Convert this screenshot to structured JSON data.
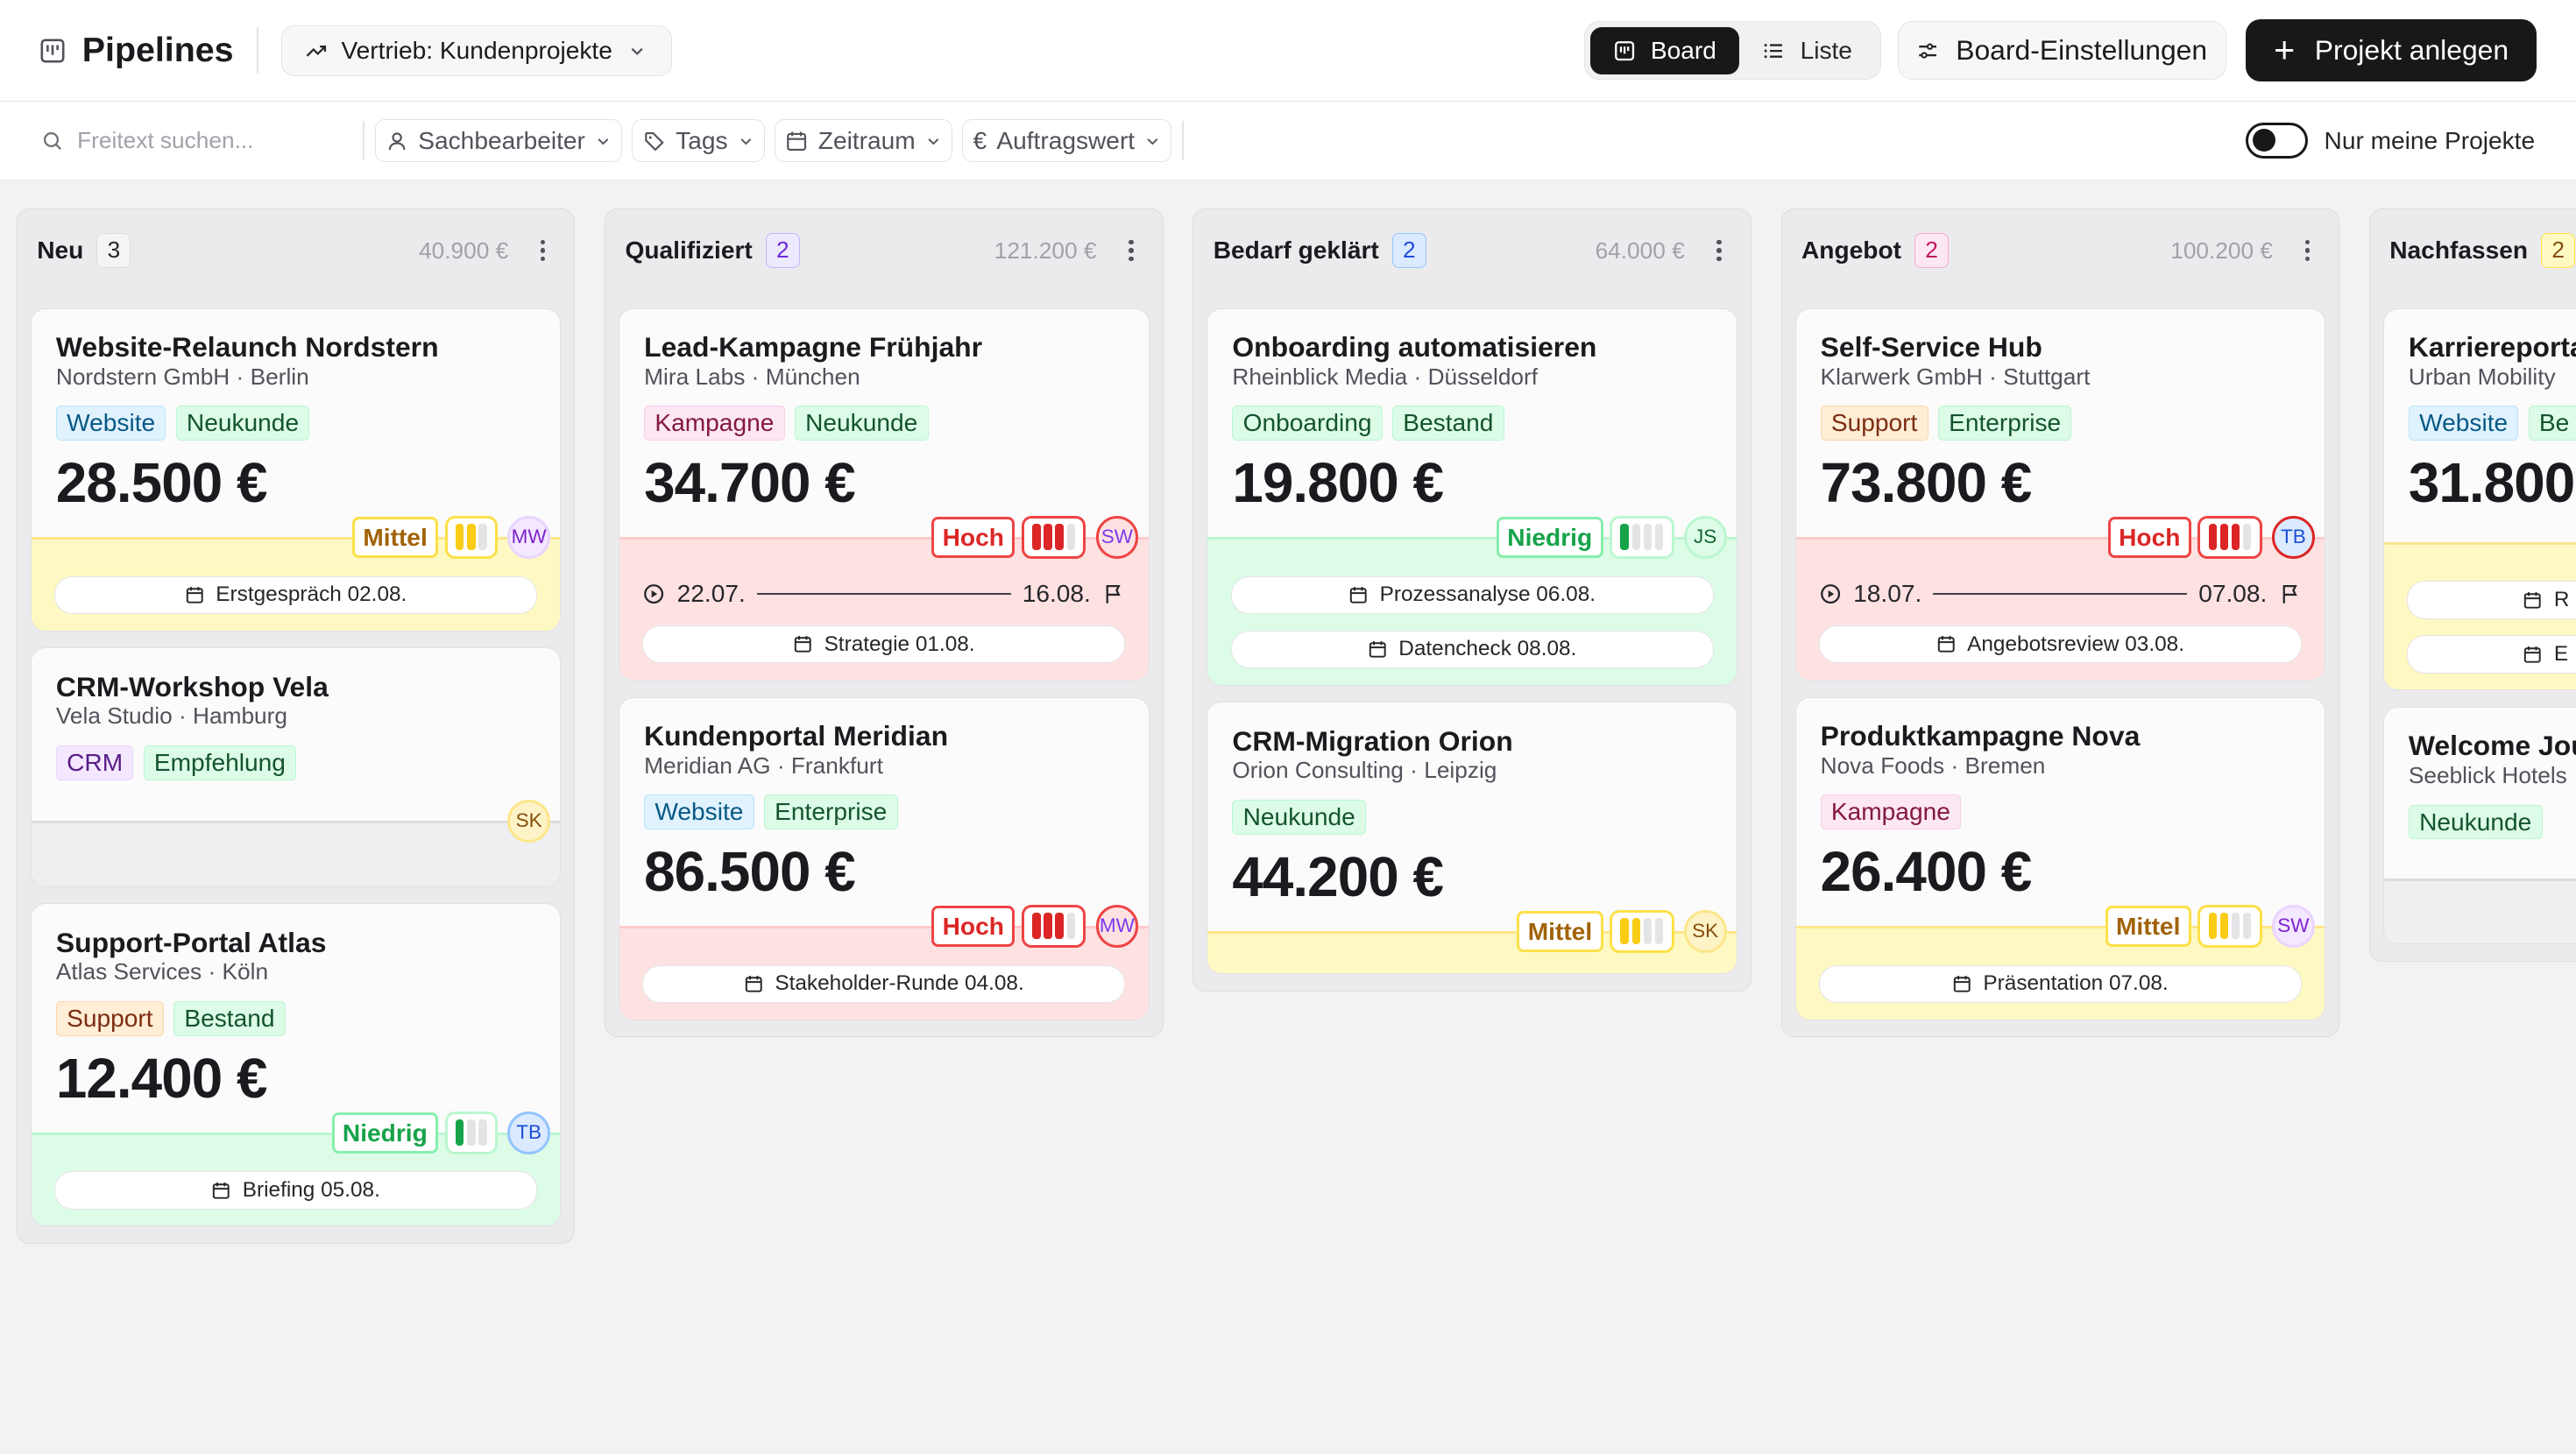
{
  "header": {
    "title": "Pipelines",
    "pipeline": "Vertrieb: Kundenprojekte",
    "view_board": "Board",
    "view_list": "Liste",
    "board_settings": "Board-Einstellungen",
    "create": "Projekt anlegen"
  },
  "filters": {
    "search_placeholder": "Freitext suchen...",
    "assignee": "Sachbearbeiter",
    "tags": "Tags",
    "period": "Zeitraum",
    "value": "Auftragswert",
    "only_mine": "Nur meine Projekte"
  },
  "columns": {
    "neu": {
      "title": "Neu",
      "count": "3",
      "sum": "40.900 €"
    },
    "qual": {
      "title": "Qualifiziert",
      "count": "2",
      "sum": "121.200 €"
    },
    "bedarf": {
      "title": "Bedarf geklärt",
      "count": "2",
      "sum": "64.000 €"
    },
    "angebot": {
      "title": "Angebot",
      "count": "2",
      "sum": "100.200 €"
    },
    "nach": {
      "title": "Nachfassen",
      "count": "2"
    }
  },
  "cards": {
    "nordstern": {
      "title": "Website-Relaunch Nordstern",
      "company": "Nordstern GmbH · Berlin",
      "tags": [
        "Website",
        "Neukunde"
      ],
      "amount": "28.500 €",
      "priority": "Mittel",
      "level": 2,
      "assignee": "MW",
      "tasks": [
        "Erstgespräch 02.08."
      ]
    },
    "vela": {
      "title": "CRM-Workshop Vela",
      "company": "Vela Studio · Hamburg",
      "tags": [
        "CRM",
        "Empfehlung"
      ],
      "assignee": "SK"
    },
    "atlas": {
      "title": "Support-Portal Atlas",
      "company": "Atlas Services · Köln",
      "tags": [
        "Support",
        "Bestand"
      ],
      "amount": "12.400 €",
      "priority": "Niedrig",
      "level": 1,
      "assignee": "TB",
      "tasks": [
        "Briefing 05.08."
      ]
    },
    "mira": {
      "title": "Lead-Kampagne Frühjahr",
      "company": "Mira Labs · München",
      "tags": [
        "Kampagne",
        "Neukunde"
      ],
      "amount": "34.700 €",
      "priority": "Hoch",
      "level": 3,
      "assignee": "SW",
      "start": "22.07.",
      "end": "16.08.",
      "tasks": [
        "Strategie 01.08."
      ]
    },
    "meridian": {
      "title": "Kundenportal Meridian",
      "company": "Meridian AG · Frankfurt",
      "tags": [
        "Website",
        "Enterprise"
      ],
      "amount": "86.500 €",
      "priority": "Hoch",
      "level": 3,
      "assignee": "MW",
      "tasks": [
        "Stakeholder-Runde 04.08."
      ]
    },
    "rheinblick": {
      "title": "Onboarding automatisieren",
      "company": "Rheinblick Media · Düsseldorf",
      "tags": [
        "Onboarding",
        "Bestand"
      ],
      "amount": "19.800 €",
      "priority": "Niedrig",
      "level": 1,
      "assignee": "JS",
      "tasks": [
        "Prozessanalyse 06.08.",
        "Datencheck 08.08."
      ]
    },
    "orion": {
      "title": "CRM-Migration Orion",
      "company": "Orion Consulting · Leipzig",
      "tags": [
        "Neukunde"
      ],
      "amount": "44.200 €",
      "priority": "Mittel",
      "level": 2,
      "assignee": "SK"
    },
    "klarwerk": {
      "title": "Self-Service Hub",
      "company": "Klarwerk GmbH · Stuttgart",
      "tags": [
        "Support",
        "Enterprise"
      ],
      "amount": "73.800 €",
      "priority": "Hoch",
      "level": 3,
      "assignee": "TB",
      "start": "18.07.",
      "end": "07.08.",
      "tasks": [
        "Angebotsreview 03.08."
      ]
    },
    "nova": {
      "title": "Produktkampagne Nova",
      "company": "Nova Foods · Bremen",
      "tags": [
        "Kampagne"
      ],
      "amount": "26.400 €",
      "priority": "Mittel",
      "level": 2,
      "assignee": "SW",
      "tasks": [
        "Präsentation 07.08."
      ]
    },
    "urban": {
      "title": "Karriereportal",
      "company": "Urban Mobility",
      "tags": [
        "Website",
        "Be"
      ],
      "amount": "31.800",
      "tasks": [
        "R",
        "E"
      ]
    },
    "seeblick": {
      "title": "Welcome Jou",
      "company": "Seeblick Hotels",
      "tags": [
        "Neukunde"
      ]
    }
  },
  "colors": {
    "accent": "#18181b",
    "high": "#dc2626",
    "medium": "#facc15",
    "low": "#16a34a"
  }
}
